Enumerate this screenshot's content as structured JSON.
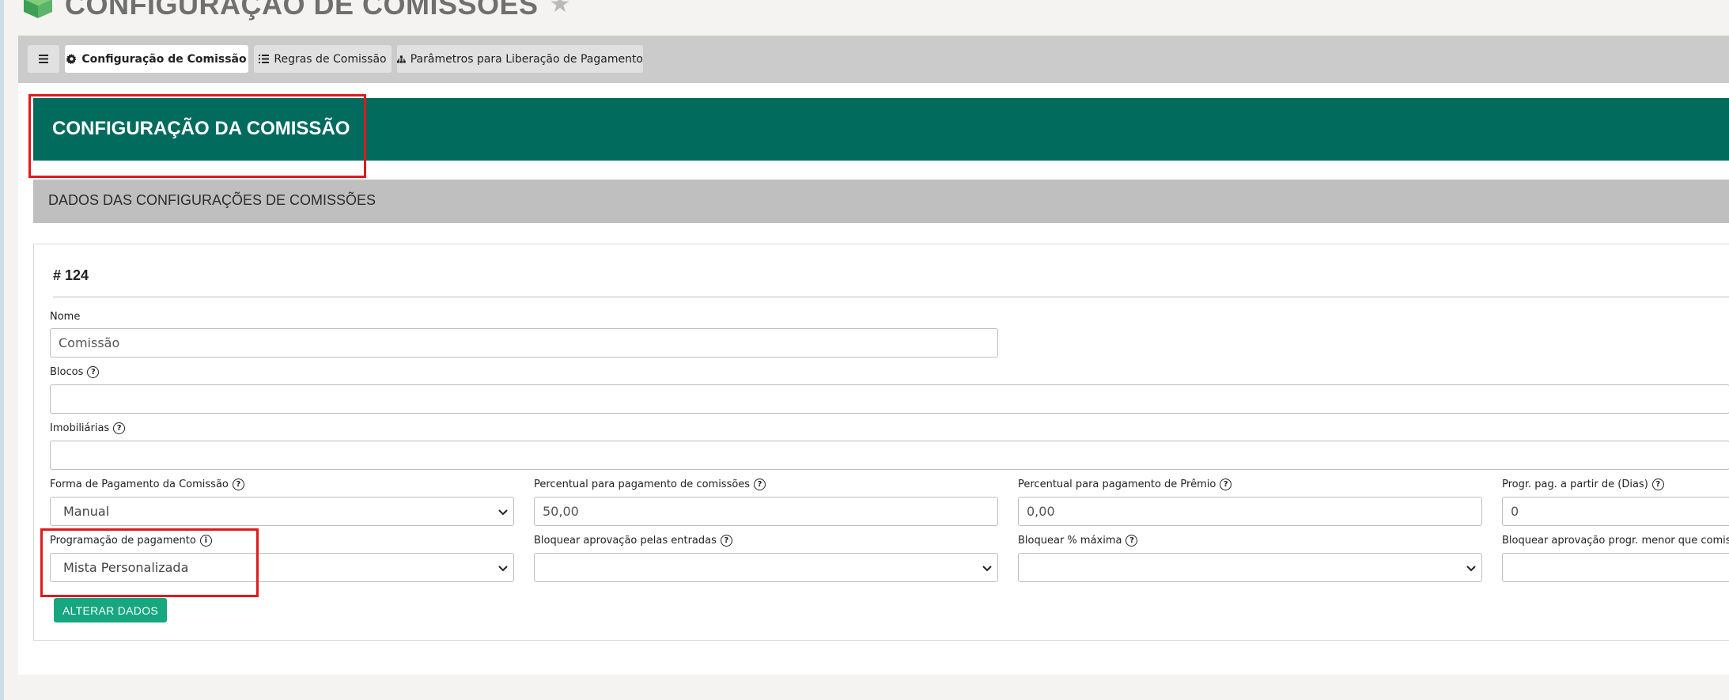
{
  "page": {
    "title": "CONFIGURAÇÃO DE COMISSÕES",
    "favorite_icon": "star-icon"
  },
  "tabs": {
    "menu_icon": "hamburger-menu-icon",
    "items": [
      {
        "label": "Configuração de Comissão",
        "icon": "gear-icon",
        "active": true
      },
      {
        "label": "Regras de Comissão",
        "icon": "list-icon",
        "active": false
      },
      {
        "label": "Parâmetros para Liberação de Pagamento",
        "icon": "sitemap-icon",
        "active": false
      }
    ]
  },
  "section": {
    "title": "CONFIGURAÇÃO DA COMISSÃO",
    "subtitle": "DADOS DAS CONFIGURAÇÕES DE COMISSÕES"
  },
  "form": {
    "record_id": "# 124",
    "nome": {
      "label": "Nome",
      "value": "Comissão"
    },
    "blocos": {
      "label": "Blocos",
      "value": ""
    },
    "imobiliarias": {
      "label": "Imobiliárias",
      "value": ""
    },
    "forma_pagamento": {
      "label": "Forma de Pagamento da Comissão",
      "value": "Manual"
    },
    "percentual_comissoes": {
      "label": "Percentual para pagamento de comissões",
      "value": "50,00"
    },
    "percentual_premio": {
      "label": "Percentual para pagamento de Prêmio",
      "value": "0,00"
    },
    "progr_dias": {
      "label": "Progr. pag. a partir de (Dias)",
      "value": "0"
    },
    "programacao_pagamento": {
      "label": "Programação de pagamento",
      "value": "Mista Personalizada"
    },
    "bloquear_entradas": {
      "label": "Bloquear aprovação pelas entradas",
      "value": ""
    },
    "bloquear_maxima": {
      "label": "Bloquear % máxima",
      "value": ""
    },
    "bloquear_progr_menor": {
      "label": "Bloquear aprovação progr. menor que comissã",
      "value": ""
    },
    "submit_label": "ALTERAR DADOS"
  },
  "colors": {
    "accent_green": "#016b5d",
    "button_green": "#16a680",
    "annotation_red": "#e0191b"
  }
}
